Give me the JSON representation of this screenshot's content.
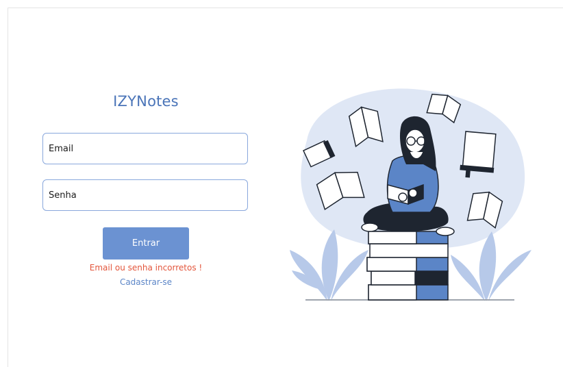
{
  "app": {
    "name": "IZYNotes"
  },
  "form": {
    "email_placeholder": "Email",
    "password_placeholder": "Senha",
    "submit_label": "Entrar",
    "error_message": "Email ou senha incorretos !",
    "register_link": "Cadastrar-se"
  },
  "colors": {
    "brand": "#4a74b8",
    "button": "#6b92d2",
    "error": "#e3553b",
    "link": "#5b85c7",
    "input_border": "#88a7dc"
  }
}
